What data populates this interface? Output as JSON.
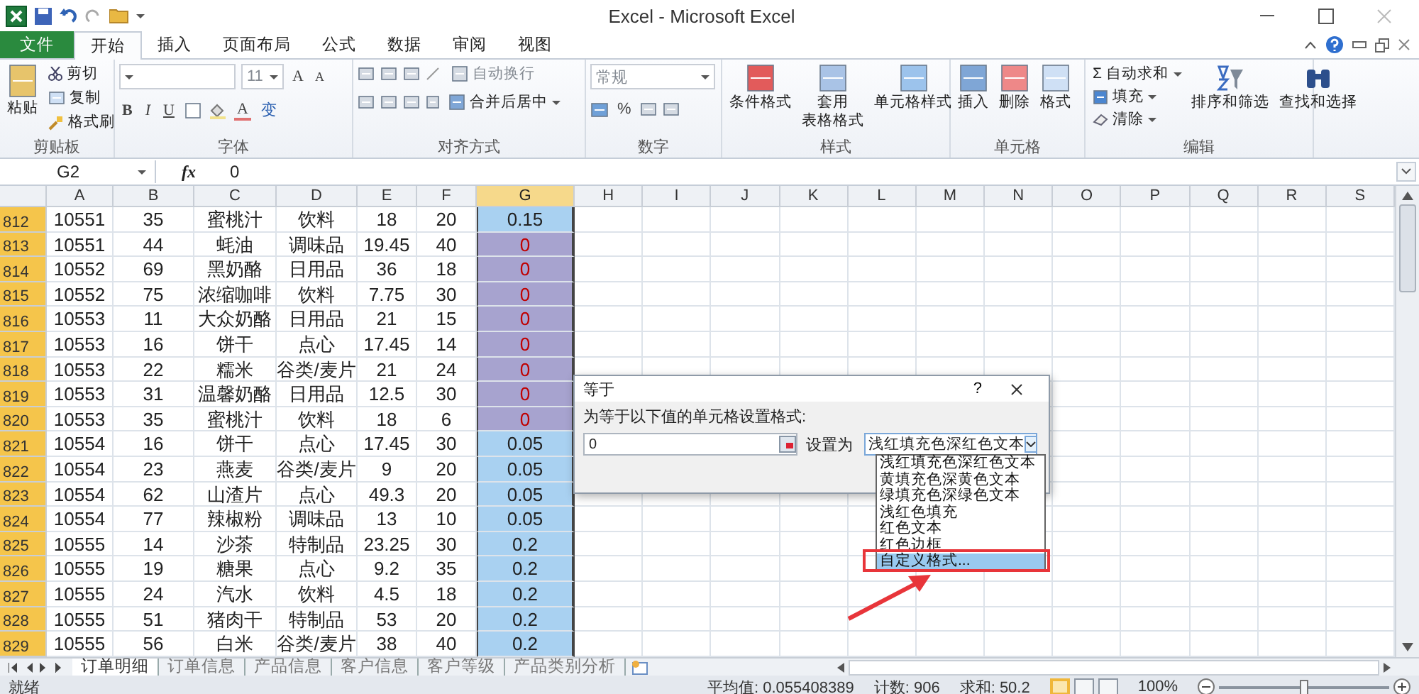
{
  "window": {
    "title": "Excel - Microsoft Excel"
  },
  "ribbon_tabs": [
    {
      "label": "文件",
      "kind": "file",
      "selected": false
    },
    {
      "label": "开始",
      "kind": "tab",
      "selected": true
    },
    {
      "label": "插入",
      "kind": "tab",
      "selected": false
    },
    {
      "label": "页面布局",
      "kind": "tab",
      "selected": false
    },
    {
      "label": "公式",
      "kind": "tab",
      "selected": false
    },
    {
      "label": "数据",
      "kind": "tab",
      "selected": false
    },
    {
      "label": "审阅",
      "kind": "tab",
      "selected": false
    },
    {
      "label": "视图",
      "kind": "tab",
      "selected": false
    }
  ],
  "ribbon": {
    "clipboard": {
      "label": "剪贴板",
      "paste": "粘贴",
      "cut": "剪切",
      "copy": "复制",
      "format_painter": "格式刷"
    },
    "font": {
      "label": "字体",
      "font_size": {
        "value": "11",
        "disabled": true
      },
      "grow": "A",
      "shrink": "A",
      "bold": "B",
      "italic": "I",
      "underline": "U",
      "font_color": "A",
      "phonetic": "变"
    },
    "alignment": {
      "label": "对齐方式",
      "wrap_text": {
        "label": "自动换行",
        "disabled": true
      },
      "merge_center": {
        "label": "合并后居中",
        "disabled": false
      }
    },
    "number": {
      "label": "数字",
      "format": {
        "value": "常规",
        "disabled": true
      },
      "percent": "%"
    },
    "styles": {
      "label": "样式",
      "conditional": "条件格式",
      "table_format": [
        "套用",
        "表格格式"
      ],
      "cell_styles": "单元格样式"
    },
    "cells": {
      "label": "单元格",
      "insert": "插入",
      "delete": "删除",
      "format": "格式"
    },
    "editing": {
      "label": "编辑",
      "sigma": "Σ",
      "autosum": "自动求和",
      "fill": "填充",
      "clear": "清除",
      "sort": "排序和筛选",
      "find": "查找和选择"
    }
  },
  "formula_bar": {
    "name_box": "G2",
    "fx": "fx",
    "value": "0"
  },
  "columns": [
    {
      "label": "A",
      "selected": false
    },
    {
      "label": "B",
      "selected": false
    },
    {
      "label": "C",
      "selected": false
    },
    {
      "label": "D",
      "selected": false
    },
    {
      "label": "E",
      "selected": false
    },
    {
      "label": "F",
      "selected": false
    },
    {
      "label": "G",
      "selected": true
    },
    {
      "label": "H",
      "selected": false
    },
    {
      "label": "I",
      "selected": false
    },
    {
      "label": "J",
      "selected": false
    },
    {
      "label": "K",
      "selected": false
    },
    {
      "label": "L",
      "selected": false
    },
    {
      "label": "M",
      "selected": false
    },
    {
      "label": "N",
      "selected": false
    },
    {
      "label": "O",
      "selected": false
    },
    {
      "label": "P",
      "selected": false
    },
    {
      "label": "Q",
      "selected": false
    },
    {
      "label": "R",
      "selected": false
    },
    {
      "label": "S",
      "selected": false
    }
  ],
  "rows": [
    {
      "number": "812",
      "selected": true,
      "highlighted": false,
      "cells": [
        "10551",
        "35",
        "蜜桃汁",
        "饮料",
        "18",
        "20",
        "0.15"
      ]
    },
    {
      "number": "813",
      "selected": true,
      "highlighted": true,
      "cells": [
        "10551",
        "44",
        "蚝油",
        "调味品",
        "19.45",
        "40",
        "0"
      ]
    },
    {
      "number": "814",
      "selected": true,
      "highlighted": true,
      "cells": [
        "10552",
        "69",
        "黑奶酪",
        "日用品",
        "36",
        "18",
        "0"
      ]
    },
    {
      "number": "815",
      "selected": true,
      "highlighted": true,
      "cells": [
        "10552",
        "75",
        "浓缩咖啡",
        "饮料",
        "7.75",
        "30",
        "0"
      ]
    },
    {
      "number": "816",
      "selected": true,
      "highlighted": true,
      "cells": [
        "10553",
        "11",
        "大众奶酪",
        "日用品",
        "21",
        "15",
        "0"
      ]
    },
    {
      "number": "817",
      "selected": true,
      "highlighted": true,
      "cells": [
        "10553",
        "16",
        "饼干",
        "点心",
        "17.45",
        "14",
        "0"
      ]
    },
    {
      "number": "818",
      "selected": true,
      "highlighted": true,
      "cells": [
        "10553",
        "22",
        "糯米",
        "谷类/麦片",
        "21",
        "24",
        "0"
      ]
    },
    {
      "number": "819",
      "selected": true,
      "highlighted": true,
      "cells": [
        "10553",
        "31",
        "温馨奶酪",
        "日用品",
        "12.5",
        "30",
        "0"
      ]
    },
    {
      "number": "820",
      "selected": true,
      "highlighted": true,
      "cells": [
        "10553",
        "35",
        "蜜桃汁",
        "饮料",
        "18",
        "6",
        "0"
      ]
    },
    {
      "number": "821",
      "selected": true,
      "highlighted": false,
      "cells": [
        "10554",
        "16",
        "饼干",
        "点心",
        "17.45",
        "30",
        "0.05"
      ]
    },
    {
      "number": "822",
      "selected": true,
      "highlighted": false,
      "cells": [
        "10554",
        "23",
        "燕麦",
        "谷类/麦片",
        "9",
        "20",
        "0.05"
      ]
    },
    {
      "number": "823",
      "selected": true,
      "highlighted": false,
      "cells": [
        "10554",
        "62",
        "山渣片",
        "点心",
        "49.3",
        "20",
        "0.05"
      ]
    },
    {
      "number": "824",
      "selected": true,
      "highlighted": false,
      "cells": [
        "10554",
        "77",
        "辣椒粉",
        "调味品",
        "13",
        "10",
        "0.05"
      ]
    },
    {
      "number": "825",
      "selected": true,
      "highlighted": false,
      "cells": [
        "10555",
        "14",
        "沙茶",
        "特制品",
        "23.25",
        "30",
        "0.2"
      ]
    },
    {
      "number": "826",
      "selected": true,
      "highlighted": false,
      "cells": [
        "10555",
        "19",
        "糖果",
        "点心",
        "9.2",
        "35",
        "0.2"
      ]
    },
    {
      "number": "827",
      "selected": true,
      "highlighted": false,
      "cells": [
        "10555",
        "24",
        "汽水",
        "饮料",
        "4.5",
        "18",
        "0.2"
      ]
    },
    {
      "number": "828",
      "selected": true,
      "highlighted": false,
      "cells": [
        "10555",
        "51",
        "猪肉干",
        "特制品",
        "53",
        "20",
        "0.2"
      ]
    },
    {
      "number": "829",
      "selected": true,
      "highlighted": false,
      "cells": [
        "10555",
        "56",
        "白米",
        "谷类/麦片",
        "38",
        "40",
        "0.2"
      ]
    }
  ],
  "dialog": {
    "title": "等于",
    "help": "?",
    "prompt": "为等于以下值的单元格设置格式:",
    "value": "0",
    "format_label": "设置为",
    "format_value": "浅红填充色深红色文本",
    "options": [
      {
        "label": "浅红填充色深红色文本",
        "selected": false
      },
      {
        "label": "黄填充色深黄色文本",
        "selected": false
      },
      {
        "label": "绿填充色深绿色文本",
        "selected": false
      },
      {
        "label": "浅红色填充",
        "selected": false
      },
      {
        "label": "红色文本",
        "selected": false
      },
      {
        "label": "红色边框",
        "selected": false
      },
      {
        "label": "自定义格式...",
        "selected": true
      }
    ]
  },
  "sheet_tabs": [
    {
      "label": "订单明细",
      "selected": true
    },
    {
      "label": "订单信息",
      "selected": false
    },
    {
      "label": "产品信息",
      "selected": false
    },
    {
      "label": "客户信息",
      "selected": false
    },
    {
      "label": "客户等级",
      "selected": false
    },
    {
      "label": "产品类别分析",
      "selected": false
    }
  ],
  "status_bar": {
    "status": "就绪",
    "average": "平均值: 0.055408389",
    "count": "计数: 906",
    "sum": "求和: 50.2",
    "views": [
      {
        "selected": true
      },
      {
        "selected": false
      },
      {
        "selected": false
      }
    ],
    "zoom": {
      "label": "100%",
      "level": 0.5
    }
  }
}
